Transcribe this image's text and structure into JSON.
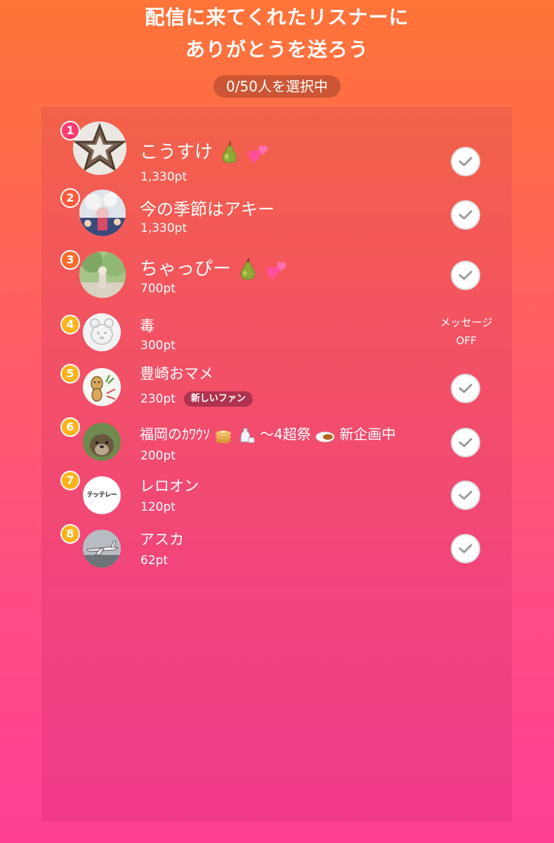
{
  "header": {
    "title_line1": "配信に来てくれたリスナーに",
    "title_line2": "ありがとうを送ろう",
    "selection_counter": "0/50人を選択中"
  },
  "listeners": [
    {
      "rank": "1",
      "name": "こうすけ",
      "emoji": [
        "pear-icon",
        "two-hearts-icon"
      ],
      "points": "1,330pt",
      "status": "check"
    },
    {
      "rank": "2",
      "name": "今の季節はアキー",
      "emoji": [],
      "points": "1,330pt",
      "status": "check"
    },
    {
      "rank": "3",
      "name": "ちゃっぴー",
      "emoji": [
        "pear-icon",
        "two-hearts-icon"
      ],
      "points": "700pt",
      "status": "check"
    },
    {
      "rank": "4",
      "name": "毒",
      "emoji": [],
      "points": "300pt",
      "status": "message-off",
      "message_label": "メッセージ",
      "message_state": "OFF"
    },
    {
      "rank": "5",
      "name": "豊崎おマメ",
      "emoji": [],
      "points": "230pt",
      "badge": "新しいファン",
      "status": "check"
    },
    {
      "rank": "6",
      "name_part1": "福岡のｶﾜｳｿ",
      "name_part2": "〜4超祭",
      "name_part3": "新企画中",
      "emoji": [
        "pancakes-icon",
        "sake-icon",
        "curry-icon"
      ],
      "points": "200pt",
      "status": "check"
    },
    {
      "rank": "7",
      "name": "レロオン",
      "avatar_text": "テッテレー",
      "emoji": [],
      "points": "120pt",
      "status": "check"
    },
    {
      "rank": "8",
      "name": "アスカ",
      "emoji": [],
      "points": "62pt",
      "status": "check"
    }
  ],
  "colors": {
    "rank_1": "#ff3a6e",
    "rank_2": "#ff5a3a",
    "rank_3": "#ff6a2a",
    "rank_4_to_8": "#ffb21a",
    "check_mark": "#9a9a9a"
  }
}
